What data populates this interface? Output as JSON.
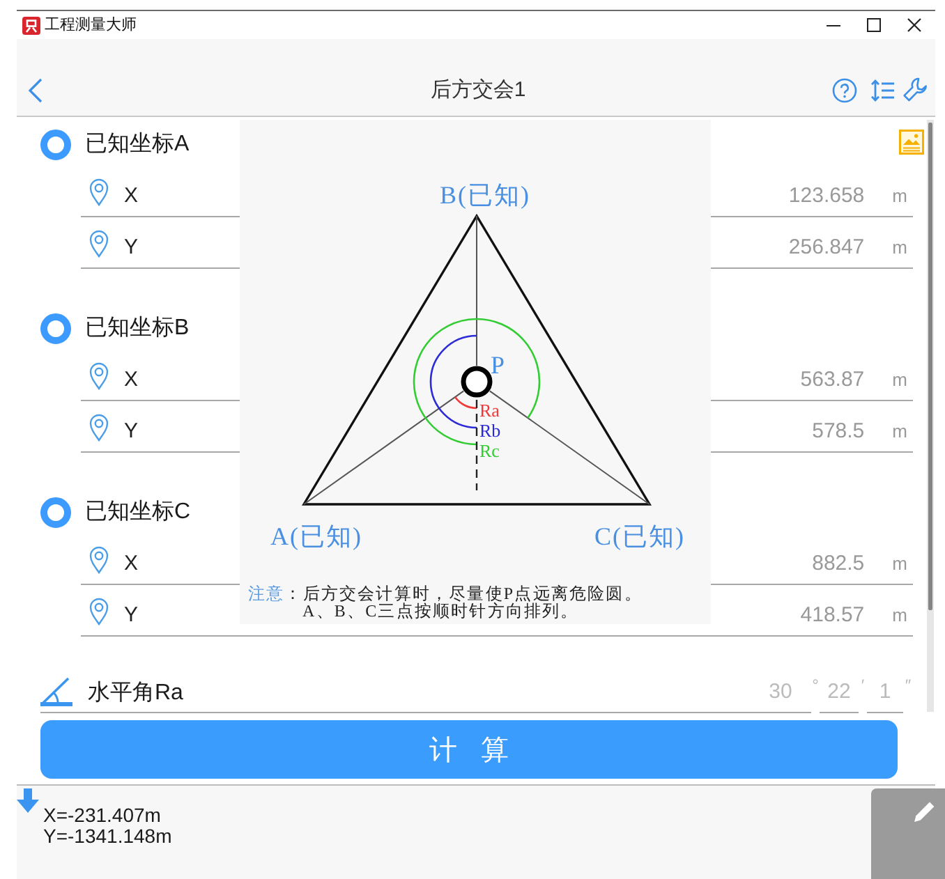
{
  "window": {
    "title": "工程测量大师"
  },
  "nav": {
    "title": "后方交会1"
  },
  "points": [
    {
      "label": "已知坐标A",
      "coords": [
        {
          "axis": "X",
          "value": "123.658",
          "unit": "m"
        },
        {
          "axis": "Y",
          "value": "256.847",
          "unit": "m"
        }
      ]
    },
    {
      "label": "已知坐标B",
      "coords": [
        {
          "axis": "X",
          "value": "563.87",
          "unit": "m"
        },
        {
          "axis": "Y",
          "value": "578.5",
          "unit": "m"
        }
      ]
    },
    {
      "label": "已知坐标C",
      "coords": [
        {
          "axis": "X",
          "value": "882.5",
          "unit": "m"
        },
        {
          "axis": "Y",
          "value": "418.57",
          "unit": "m"
        }
      ]
    }
  ],
  "diagram": {
    "vertices": [
      {
        "label": "A(已知)"
      },
      {
        "label": "B(已知)"
      },
      {
        "label": "C(已知)"
      }
    ],
    "station": "P",
    "radii": [
      {
        "label": "Ra",
        "color": "#f03a3a"
      },
      {
        "label": "Rb",
        "color": "#2b2bd8"
      },
      {
        "label": "Rc",
        "color": "#33cc33"
      }
    ],
    "note": {
      "label": "注意",
      "lines": [
        "：后方交会计算时，尽量使P点远离危险圆。",
        "A、B、C三点按顺时针方向排列。"
      ]
    }
  },
  "angle": {
    "label": "水平角Ra",
    "parts": [
      {
        "value": "30",
        "mark": "°"
      },
      {
        "value": "22",
        "mark": "′"
      },
      {
        "value": "1",
        "mark": "″"
      }
    ]
  },
  "button": {
    "label": "计算"
  },
  "result": {
    "lines": [
      "X=-231.407m",
      "Y=-1341.148m"
    ]
  }
}
